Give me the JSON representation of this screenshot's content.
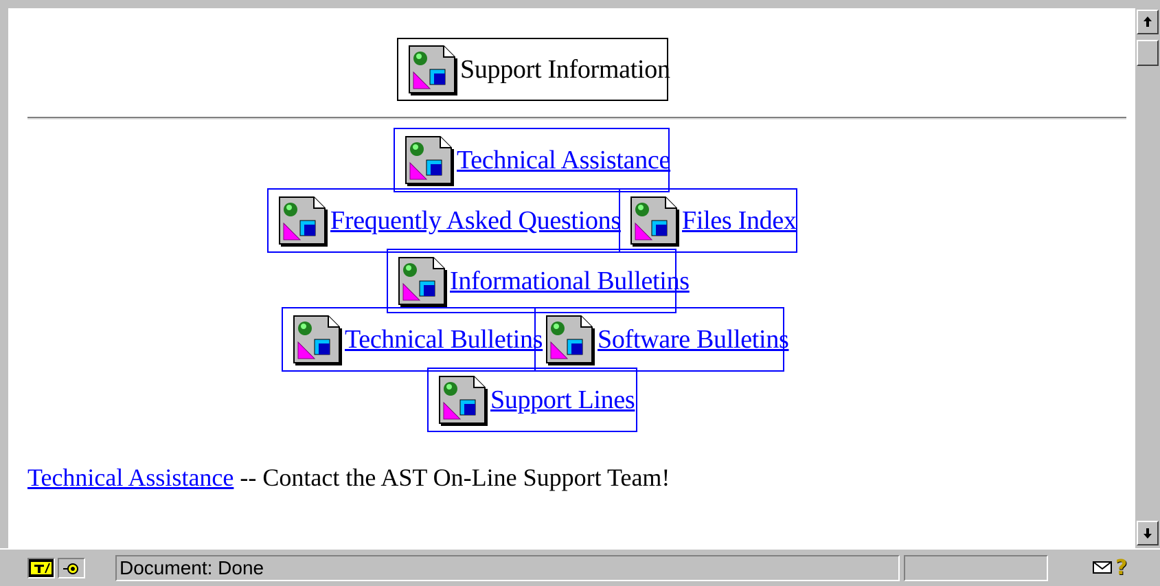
{
  "content": {
    "header_image_label": "Support Information",
    "nav": {
      "technical_assistance": "Technical Assistance",
      "faq": "Frequently Asked Questions",
      "files_index": "Files Index",
      "informational_bulletins": "Informational Bulletins",
      "technical_bulletins": "Technical Bulletins",
      "software_bulletins": "Software Bulletins",
      "support_lines": "Support Lines"
    },
    "footer_link": "Technical Assistance",
    "footer_text": "-- Contact the AST On-Line Support Team!"
  },
  "statusbar": {
    "text": "Document: Done",
    "help_glyph": "?"
  },
  "icons": {
    "broken_image": "broken-image-icon",
    "mail": "mail-icon",
    "security": "security-icon",
    "scroll_up": "scroll-up-arrow-icon",
    "scroll_down": "scroll-down-arrow-icon"
  },
  "colors": {
    "link": "#0000ff",
    "chrome": "#c0c0c0"
  }
}
